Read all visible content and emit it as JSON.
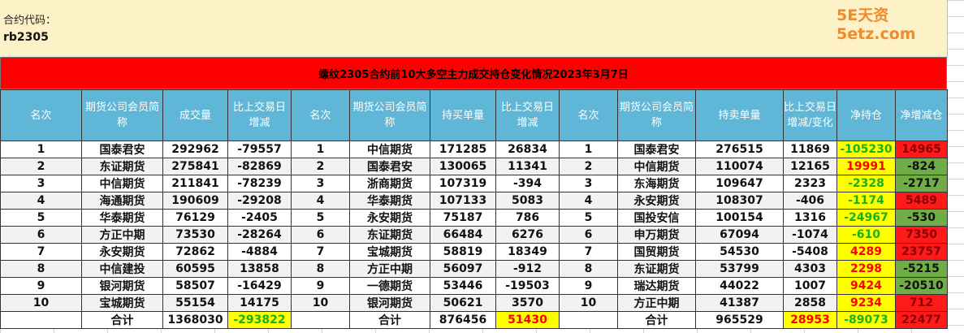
{
  "info": {
    "label": "合约代码：",
    "code": "rb2305"
  },
  "watermark": "5E天资5etz.com",
  "title": "螺纹2305合约前10大多空主力成交持仓变化情况2023年3月7日",
  "headers": [
    "名次",
    "期货公司会员简称",
    "成交量",
    "比上交易日增减",
    "名次",
    "期货公司会员简称",
    "持买单量",
    "比上交易日增减",
    "名次",
    "期货公司会员简称",
    "持卖单量",
    "比上交易日增减/变化",
    "净持仓",
    "净增减仓"
  ],
  "rows": [
    [
      "1",
      "国泰君安",
      "292962",
      "-79557",
      "1",
      "中信期货",
      "171285",
      "26834",
      "1",
      "国泰君安",
      "276515",
      "11869",
      "-105230",
      "14965"
    ],
    [
      "2",
      "东证期货",
      "275841",
      "-82869",
      "2",
      "国泰君安",
      "130065",
      "11341",
      "2",
      "中信期货",
      "110074",
      "12165",
      "19991",
      "-824"
    ],
    [
      "3",
      "中信期货",
      "211841",
      "-78239",
      "3",
      "浙商期货",
      "107319",
      "-394",
      "3",
      "东海期货",
      "109647",
      "2323",
      "-2328",
      "-2717"
    ],
    [
      "4",
      "海通期货",
      "190609",
      "-29208",
      "4",
      "华泰期货",
      "107133",
      "5083",
      "4",
      "永安期货",
      "108307",
      "-406",
      "-1174",
      "5489"
    ],
    [
      "5",
      "华泰期货",
      "76129",
      "-2405",
      "5",
      "永安期货",
      "75187",
      "786",
      "5",
      "国投安信",
      "100154",
      "1316",
      "-24967",
      "-530"
    ],
    [
      "6",
      "方正中期",
      "73530",
      "-28264",
      "6",
      "东证期货",
      "66484",
      "6276",
      "6",
      "申万期货",
      "67094",
      "-1074",
      "-610",
      "7350"
    ],
    [
      "7",
      "永安期货",
      "72862",
      "-4884",
      "7",
      "宝城期货",
      "58819",
      "18349",
      "7",
      "国贸期货",
      "54530",
      "-5408",
      "4289",
      "23757"
    ],
    [
      "8",
      "中信建投",
      "60595",
      "13858",
      "8",
      "方正中期",
      "56097",
      "-912",
      "8",
      "东证期货",
      "53799",
      "4303",
      "2298",
      "-5215"
    ],
    [
      "9",
      "银河期货",
      "58507",
      "-16429",
      "9",
      "一德期货",
      "53446",
      "-19503",
      "9",
      "瑞达期货",
      "44022",
      "1007",
      "9424",
      "-20510"
    ],
    [
      "10",
      "宝城期货",
      "55154",
      "14175",
      "10",
      "银河期货",
      "50621",
      "3570",
      "10",
      "方正中期",
      "41387",
      "2858",
      "9234",
      "712"
    ]
  ],
  "total": {
    "label": "合计",
    "volume": "1368030",
    "volume_change": "-293822",
    "buy": "876456",
    "buy_change": "51430",
    "sell": "965529",
    "sell_change": "28953",
    "net": "-89073",
    "net_change": "22477"
  },
  "colors": {
    "header_bg": "#5fb6d6",
    "title_bg": "#ff0000",
    "info_bg": "#fdf2c7"
  }
}
